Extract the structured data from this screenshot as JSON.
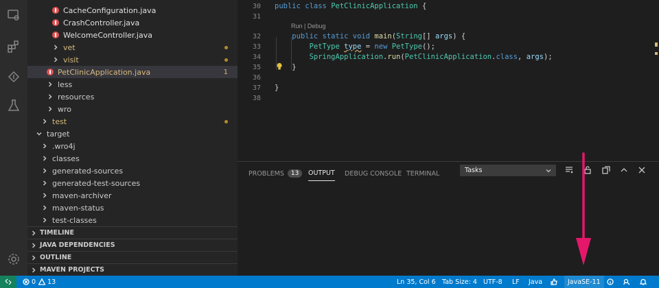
{
  "explorer": {
    "items": [
      {
        "label": "CacheConfiguration.java",
        "kind": "error-file",
        "indent": 2
      },
      {
        "label": "CrashController.java",
        "kind": "error-file",
        "indent": 2
      },
      {
        "label": "WelcomeController.java",
        "kind": "error-file",
        "indent": 2
      },
      {
        "label": "vet",
        "kind": "folder-modified",
        "indent": 2
      },
      {
        "label": "visit",
        "kind": "folder-modified",
        "indent": 2
      },
      {
        "label": "PetClinicApplication.java",
        "kind": "error-file-selected",
        "indent": 1,
        "badge": "1"
      },
      {
        "label": "less",
        "kind": "folder",
        "indent": 1
      },
      {
        "label": "resources",
        "kind": "folder",
        "indent": 1
      },
      {
        "label": "wro",
        "kind": "folder",
        "indent": 1
      },
      {
        "label": "test",
        "kind": "folder-modified",
        "indent": 0
      },
      {
        "label": "target",
        "kind": "folder-open",
        "indent": -1
      },
      {
        "label": ".wro4j",
        "kind": "folder",
        "indent": 0
      },
      {
        "label": "classes",
        "kind": "folder",
        "indent": 0
      },
      {
        "label": "generated-sources",
        "kind": "folder",
        "indent": 0
      },
      {
        "label": "generated-test-sources",
        "kind": "folder",
        "indent": 0
      },
      {
        "label": "maven-archiver",
        "kind": "folder",
        "indent": 0
      },
      {
        "label": "maven-status",
        "kind": "folder",
        "indent": 0
      },
      {
        "label": "test-classes",
        "kind": "folder",
        "indent": 0
      }
    ],
    "sections": [
      "TIMELINE",
      "JAVA DEPENDENCIES",
      "OUTLINE",
      "MAVEN PROJECTS"
    ]
  },
  "editor": {
    "codelens": "Run | Debug",
    "lines": [
      {
        "n": "30",
        "tokens": [
          [
            "kw",
            "public "
          ],
          [
            "kw",
            "class "
          ],
          [
            "cls",
            "PetClinicApplication"
          ],
          [
            "pl",
            " {"
          ]
        ]
      },
      {
        "n": "31",
        "tokens": []
      },
      {
        "n": "32",
        "tokens": [
          [
            "kw",
            "    public static void "
          ],
          [
            "fn",
            "main"
          ],
          [
            "pl",
            "("
          ],
          [
            "cls",
            "String"
          ],
          [
            "pl",
            "[] "
          ],
          [
            "var",
            "args"
          ],
          [
            "pl",
            ") {"
          ]
        ]
      },
      {
        "n": "33",
        "tokens": [
          [
            "cls",
            "        PetType "
          ],
          [
            "sq",
            "type"
          ],
          [
            "pl",
            " = "
          ],
          [
            "kw",
            "new "
          ],
          [
            "cls",
            "PetType"
          ],
          [
            "pl",
            "();"
          ]
        ]
      },
      {
        "n": "34",
        "tokens": [
          [
            "cls",
            "        SpringApplication"
          ],
          [
            "pl",
            "."
          ],
          [
            "fn",
            "run"
          ],
          [
            "pl",
            "("
          ],
          [
            "cls",
            "PetClinicApplication"
          ],
          [
            "pl",
            "."
          ],
          [
            "kw",
            "class"
          ],
          [
            "pl",
            ", "
          ],
          [
            "var",
            "args"
          ],
          [
            "pl",
            ");"
          ]
        ]
      },
      {
        "n": "35",
        "tokens": [
          [
            "pl",
            "    }"
          ]
        ]
      },
      {
        "n": "36",
        "tokens": []
      },
      {
        "n": "37",
        "tokens": [
          [
            "pl",
            "}"
          ]
        ]
      },
      {
        "n": "38",
        "tokens": []
      }
    ]
  },
  "panel": {
    "tabs": [
      {
        "label": "PROBLEMS",
        "badge": "13"
      },
      {
        "label": "OUTPUT"
      },
      {
        "label": "DEBUG CONSOLE"
      },
      {
        "label": "TERMINAL"
      }
    ],
    "output_select": "Tasks"
  },
  "status": {
    "errors": "0",
    "warnings": "13",
    "position": "Ln 35, Col 6",
    "tab_size": "Tab Size: 4",
    "encoding": "UTF-8",
    "eol": "LF",
    "language": "Java",
    "runtime": "JavaSE-11"
  },
  "colors": {
    "status_bar": "#007acc",
    "remote": "#16825d",
    "arrow": "#e5176b",
    "error": "#e05252",
    "modified": "#b58b2e"
  }
}
